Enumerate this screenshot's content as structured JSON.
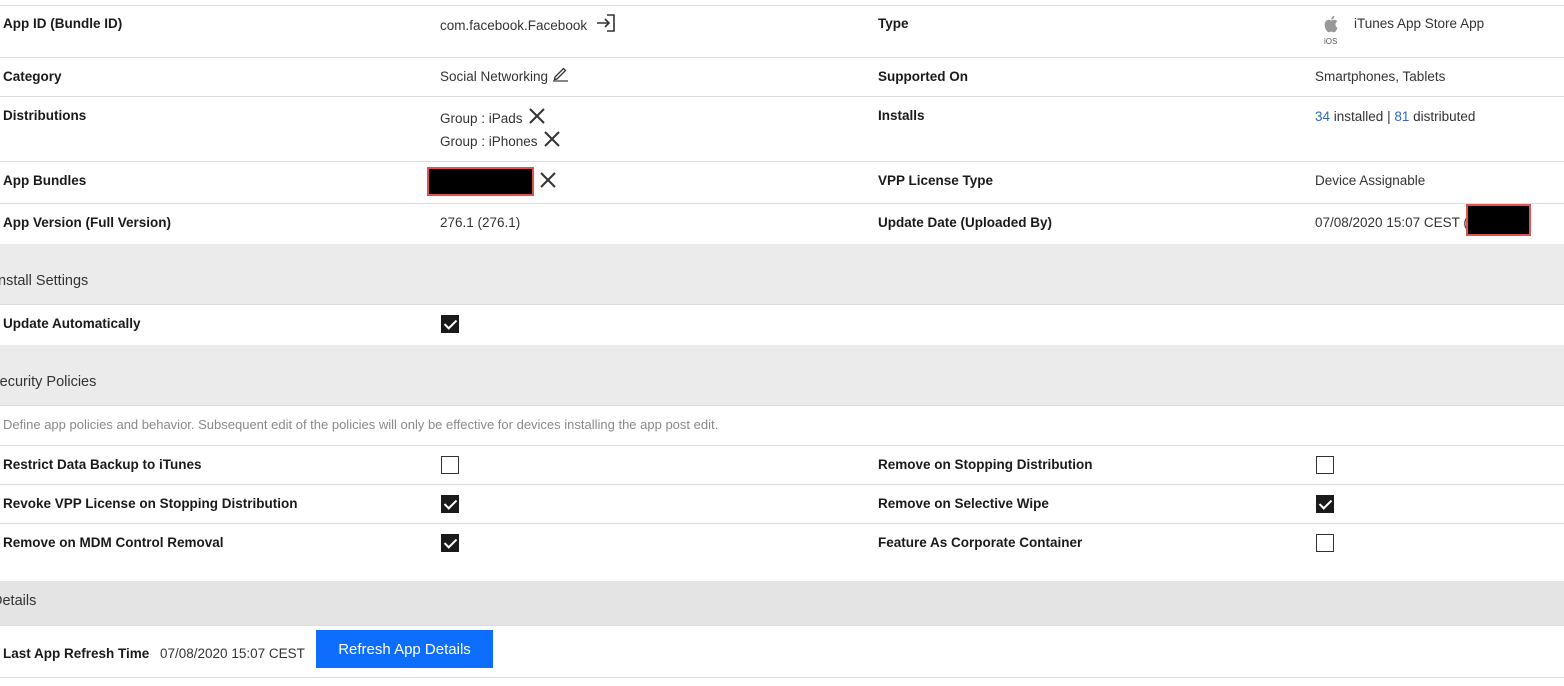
{
  "info": {
    "app_id_label": "App ID (Bundle ID)",
    "app_id_value": "com.facebook.Facebook",
    "type_label": "Type",
    "type_value": "iTunes App Store App",
    "type_os_tag": "iOS",
    "category_label": "Category",
    "category_value": "Social Networking",
    "supported_label": "Supported On",
    "supported_value": "Smartphones, Tablets",
    "distributions_label": "Distributions",
    "distributions": [
      "Group : iPads",
      "Group : iPhones"
    ],
    "installs_label": "Installs",
    "installs_installed_count": "34",
    "installs_installed_text": " installed | ",
    "installs_distributed_count": "81",
    "installs_distributed_text": " distributed",
    "bundles_label": "App Bundles",
    "vpp_label": "VPP License Type",
    "vpp_value": "Device Assignable",
    "version_label": "App Version (Full Version)",
    "version_value": "276.1 (276.1)",
    "update_label": "Update Date (Uploaded By)",
    "update_value": "07/08/2020 15:07 CEST ("
  },
  "install_settings": {
    "title": "Install Settings",
    "update_auto_label": "Update Automatically",
    "update_auto_checked": true
  },
  "security": {
    "title": "Security Policies",
    "description": "Define app policies and behavior. Subsequent edit of the policies will only be effective for devices installing the app post edit.",
    "restrict_backup_label": "Restrict Data Backup to iTunes",
    "restrict_backup_checked": false,
    "remove_stop_dist_label": "Remove on Stopping Distribution",
    "remove_stop_dist_checked": false,
    "revoke_vpp_label": "Revoke VPP License on Stopping Distribution",
    "revoke_vpp_checked": true,
    "remove_selective_wipe_label": "Remove on Selective Wipe",
    "remove_selective_wipe_checked": true,
    "remove_mdm_label": "Remove on MDM Control Removal",
    "remove_mdm_checked": true,
    "corporate_container_label": "Feature As Corporate Container",
    "corporate_container_checked": false
  },
  "details": {
    "title": "Details",
    "refresh_time_label": "Last App Refresh Time",
    "refresh_time_value": "07/08/2020 15:07 CEST",
    "refresh_button_label": "Refresh App Details"
  },
  "colors": {
    "link": "#2f6bb5",
    "button": "#0d6efd",
    "section_bg": "#ebebeb",
    "redaction_border": "#e05353"
  },
  "icons": [
    "export-icon",
    "apple-icon",
    "edit-pencil-icon",
    "close-icon"
  ]
}
